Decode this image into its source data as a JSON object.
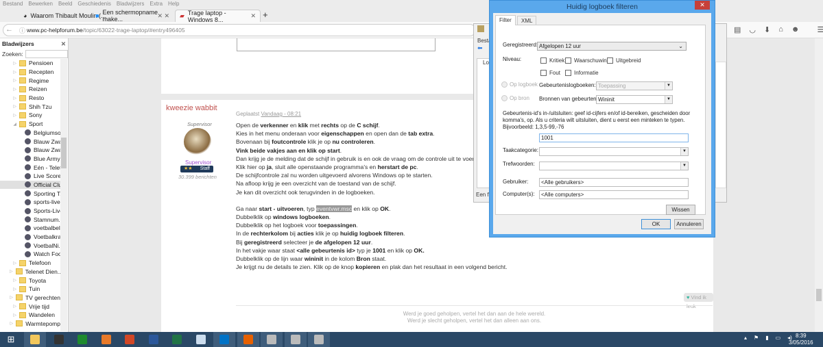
{
  "browser": {
    "menu": [
      "Bestand",
      "Bewerken",
      "Beeld",
      "Geschiedenis",
      "Bladwijzers",
      "Extra",
      "Help"
    ],
    "tabs": [
      {
        "label": "Waarom Thibault Moulin (..."
      },
      {
        "label": "Een schermopname make..."
      },
      {
        "label": "Trage laptop - Windows 8..."
      }
    ],
    "url_host": "www.pc-helpforum.be",
    "url_path": "/topic/63022-trage-laptop/#entry496405"
  },
  "sidebar": {
    "title": "Bladwijzers",
    "search_label": "Zoeken:",
    "folders_top": [
      "Pensioen",
      "Recepten",
      "Regime",
      "Reizen",
      "Resto",
      "Shih Tzu",
      "Sony"
    ],
    "open_folder": "Sport",
    "children": [
      "Belgiumso...",
      "Blauw Zwa...",
      "Blauw Zwa...",
      "Blue Army ...",
      "Eén - Telet...",
      "Live Score ...",
      "Official Clu...",
      "Sporting T...",
      "sports-live...",
      "Sports-Livez",
      "Stamnum...",
      "voetbalbel...",
      "Voetbalkra...",
      "VoetbalNi...",
      "Watch Foo..."
    ],
    "folders_bottom": [
      "Telefoon",
      "Telenet Dien...",
      "Toyota",
      "Tuin",
      "TV gerechten",
      "Vrije tijd",
      "Wandelen",
      "Warmtepomp"
    ]
  },
  "post": {
    "author": "kweezie wabbit",
    "role": "Supervisor",
    "group": "Supervisor",
    "badge_stars": "★★",
    "badge": "Staff",
    "posts": "30.399 berichten",
    "posted_label": "Geplaatst",
    "posted_time": "Vandaag - 08:21",
    "lines": [
      [
        [
          "Open de ",
          0
        ],
        [
          "verkenner",
          1
        ],
        [
          " en ",
          0
        ],
        [
          "klik",
          1
        ],
        [
          " met ",
          0
        ],
        [
          "rechts",
          1
        ],
        [
          " op de ",
          0
        ],
        [
          "C schijf",
          1
        ],
        [
          ".",
          0
        ]
      ],
      [
        [
          "Kies in het menu onderaan voor ",
          0
        ],
        [
          "eigenschappen",
          1
        ],
        [
          " en open dan de ",
          0
        ],
        [
          "tab extra",
          1
        ],
        [
          ".",
          0
        ]
      ],
      [
        [
          "Bovenaan bij ",
          0
        ],
        [
          "foutcontrole",
          1
        ],
        [
          " klik je op ",
          0
        ],
        [
          "nu controleren",
          1
        ],
        [
          ".",
          0
        ]
      ],
      [
        [
          "Vink beide vakjes aan en klik op start",
          1
        ],
        [
          ".",
          0
        ]
      ],
      [
        [
          "Dan krijg je de melding dat de schijf in gebruik is en ook de vraag om de controle uit te voeren bij",
          0
        ]
      ],
      [
        [
          "Klik hier op ",
          0
        ],
        [
          "ja",
          1
        ],
        [
          ", sluit alle openstaande programma's en ",
          0
        ],
        [
          "herstart de pc",
          1
        ],
        [
          ".",
          0
        ]
      ],
      [
        [
          "De schijfcontrole zal nu worden uitgevoerd alvorens Windows op te starten.",
          0
        ]
      ],
      [
        [
          "Na afloop krijg je een overzicht van de toestand van de schijf.",
          0
        ]
      ],
      [
        [
          "Je kan dit overzicht ook terugvinden in de logboeken.",
          0
        ]
      ],
      [],
      [
        [
          "Ga naar ",
          0
        ],
        [
          "start - uitvoeren",
          1
        ],
        [
          ", typ ",
          0
        ],
        [
          "eventvwr.msc",
          2
        ],
        [
          " en klik op ",
          0
        ],
        [
          "OK",
          1
        ],
        [
          ".",
          0
        ]
      ],
      [
        [
          "Dubbelklik op ",
          0
        ],
        [
          "windows logboeken",
          1
        ],
        [
          ".",
          0
        ]
      ],
      [
        [
          "Dubbelklik op het logboek voor ",
          0
        ],
        [
          "toepassingen",
          1
        ],
        [
          ".",
          0
        ]
      ],
      [
        [
          "In de ",
          0
        ],
        [
          "rechterkolom",
          1
        ],
        [
          " bij ",
          0
        ],
        [
          "acties",
          1
        ],
        [
          " klik je op ",
          0
        ],
        [
          "huidig logboek filteren",
          1
        ],
        [
          ".",
          0
        ]
      ],
      [
        [
          "Bij ",
          0
        ],
        [
          "geregistreerd",
          1
        ],
        [
          " selecteer je ",
          0
        ],
        [
          "de afgelopen 12 uur",
          1
        ],
        [
          ".",
          0
        ]
      ],
      [
        [
          "In het vakje waar staat ",
          0
        ],
        [
          "<alle gebeurtenis id>",
          1
        ],
        [
          " typ je ",
          0
        ],
        [
          "1001",
          1
        ],
        [
          " en klik op ",
          0
        ],
        [
          "OK.",
          1
        ]
      ],
      [
        [
          "Dubbelklik op de lijn waar ",
          0
        ],
        [
          "wininit",
          1
        ],
        [
          " in de kolom ",
          0
        ],
        [
          "Bron",
          1
        ],
        [
          " staat.",
          0
        ]
      ],
      [
        [
          "Je krijgt nu de details te zien. Klik op de knop ",
          0
        ],
        [
          "kopieren",
          1
        ],
        [
          " en plak dan het resultaat in een volgend bericht.",
          0
        ]
      ]
    ],
    "like": "Vind ik leuk",
    "footer1": "Werd je goed geholpen, vertel het dan aan de hele wereld.",
    "footer2": "Werd je slecht geholpen, vertel het dan alleen aan ons."
  },
  "eventviewer": {
    "menu": "Besta",
    "tree_item": "Lo",
    "status": "Een filt"
  },
  "dialog": {
    "title": "Huidig logboek filteren",
    "close": "✕",
    "tabs": [
      "Filter",
      "XML"
    ],
    "geregistreerd_label": "Geregistreerd:",
    "geregistreerd_value": "Afgelopen 12 uur",
    "niveau_label": "Niveau:",
    "levels": [
      {
        "label": "Kritiek",
        "checked": false
      },
      {
        "label": "Waarschuwing",
        "checked": false
      },
      {
        "label": "Uitgebreid",
        "checked": false
      },
      {
        "label": "Fout",
        "checked": false
      },
      {
        "label": "Informatie",
        "checked": false
      }
    ],
    "radio_logboek": "Op logboek",
    "radio_bron": "Op bron",
    "logboeken_label": "Gebeurtenislogboeken:",
    "logboeken_value": "Toepassing",
    "bronnen_label": "Bronnen van gebeurtenis:",
    "bronnen_value": "Wininit",
    "help_text": "Gebeurtenis-id's in-/uitsluiten: geef id-cijfers en/of id-bereiken, gescheiden door komma's, op. Als u criteria wilt uitsluiten, dient u eerst een minteken te typen. Bijvoorbeeld: 1,3,5-99,-76",
    "id_value": "1001",
    "taak_label": "Taakcategorie:",
    "taak_value": "",
    "tref_label": "Trefwoorden:",
    "tref_value": "",
    "gebruiker_label": "Gebruiker:",
    "gebruiker_value": "<Alle gebruikers>",
    "computer_label": "Computer(s):",
    "computer_value": "<Alle computers>",
    "wissen": "Wissen",
    "ok": "OK",
    "annuleren": "Annuleren"
  },
  "taskbar": {
    "apps": [
      {
        "icon": "file-explorer-icon",
        "color": "#f2c75c"
      },
      {
        "icon": "hp-icon",
        "color": "#333"
      },
      {
        "icon": "calculator-icon",
        "color": "#1e8a2e"
      },
      {
        "icon": "photo-icon",
        "color": "#e87a2a"
      },
      {
        "icon": "powerpoint-icon",
        "color": "#d24726"
      },
      {
        "icon": "word-icon",
        "color": "#2b579a"
      },
      {
        "icon": "excel-icon",
        "color": "#217346"
      },
      {
        "icon": "scheduler-icon",
        "color": "#cde"
      },
      {
        "icon": "outlook-icon",
        "color": "#0072c6"
      },
      {
        "icon": "firefox-icon",
        "color": "#e66000"
      },
      {
        "icon": "event-viewer-icon",
        "color": "#bbb"
      },
      {
        "icon": "event-viewer-icon",
        "color": "#bbb"
      },
      {
        "icon": "event-viewer-icon",
        "color": "#bbb"
      }
    ],
    "time": "8:39",
    "date": "3/05/2016"
  }
}
